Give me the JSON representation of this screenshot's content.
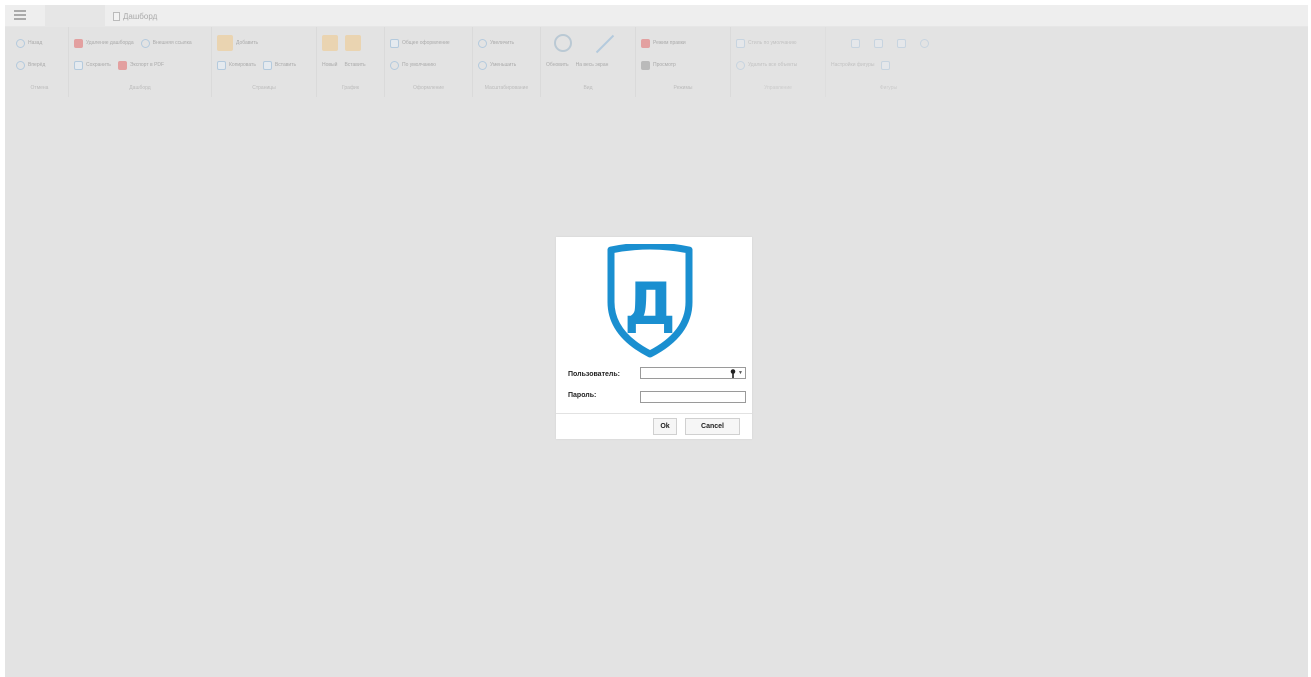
{
  "window": {
    "doc_tab_label": "Дашборд"
  },
  "ribbon": {
    "groups": [
      {
        "label": "Отмена",
        "items": [
          "Назад",
          "Вперёд"
        ]
      },
      {
        "label": "Дашборд",
        "items": [
          "Удаление дашборда",
          "Внешняя ссылка",
          "Сохранить",
          "Экспорт в PDF"
        ]
      },
      {
        "label": "Страницы",
        "items": [
          "Добавить",
          "Копировать",
          "Вставить"
        ]
      },
      {
        "label": "График",
        "items": [
          "Новый",
          "Вставить"
        ]
      },
      {
        "label": "Оформление",
        "items": [
          "Общее оформление",
          "По умолчанию"
        ]
      },
      {
        "label": "Масштабирование",
        "items": [
          "Увеличить",
          "Уменьшить"
        ]
      },
      {
        "label": "Вид",
        "items": [
          "Обновить",
          "На весь экран"
        ]
      },
      {
        "label": "Режимы",
        "items": [
          "Режим правки",
          "Просмотр"
        ]
      },
      {
        "label": "Управление",
        "items": [
          "Стиль по умолчанию",
          "Удалить все объекты"
        ]
      },
      {
        "label": "Фигуры",
        "items": [
          "Настройки фигуры"
        ]
      }
    ]
  },
  "login": {
    "user_label": "Пользователь:",
    "password_label": "Пароль:",
    "user_value": "",
    "password_value": "",
    "ok_label": "Ok",
    "cancel_label": "Cancel",
    "logo_letter": "Д"
  },
  "colors": {
    "brand": "#1a8fd0",
    "background": "#e3e3e3"
  }
}
